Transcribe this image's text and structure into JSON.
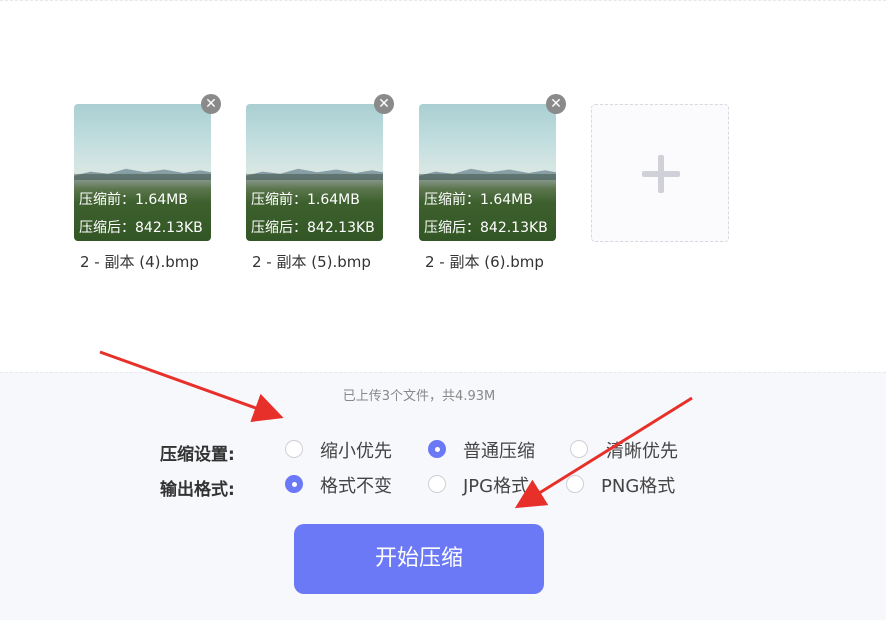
{
  "files": [
    {
      "name": "2 - 副本 (4).bmp",
      "before": "压缩前：1.64MB",
      "after": "压缩后：842.13KB"
    },
    {
      "name": "2 - 副本 (5).bmp",
      "before": "压缩前：1.64MB",
      "after": "压缩后：842.13KB"
    },
    {
      "name": "2 - 副本 (6).bmp",
      "before": "压缩前：1.64MB",
      "after": "压缩后：842.13KB"
    }
  ],
  "remove_glyph": "✕",
  "summary": "已上传3个文件，共4.93M",
  "compression": {
    "label": "压缩设置:",
    "options": [
      "缩小优先",
      "普通压缩",
      "清晰优先"
    ],
    "selected": "普通压缩"
  },
  "format": {
    "label": "输出格式:",
    "options": [
      "格式不变",
      "JPG格式",
      "PNG格式"
    ],
    "selected": "格式不变"
  },
  "start_button": "开始压缩",
  "colors": {
    "accent": "#6b79f7",
    "annotation_arrow": "#e8302a",
    "bottom_panel": "#f7f8fc"
  }
}
